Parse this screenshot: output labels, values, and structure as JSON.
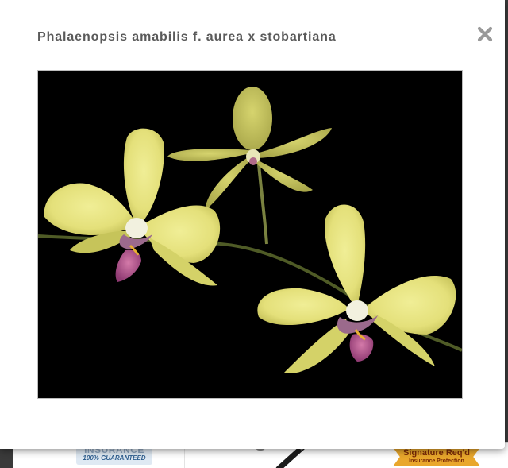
{
  "modal": {
    "title": "Phalaenopsis amabilis f. aurea x stobartiana",
    "close_icon": "close-icon"
  },
  "photo": {
    "subject": "orchid-flowers",
    "background_color": "#000000",
    "petal_color": "#e6e37e",
    "lip_color": "#b7458f"
  },
  "background_page": {
    "badges": [
      {
        "line1": "INSURANCE",
        "line2": "100% GUARANTEED"
      },
      {
        "icon": "pen-icon"
      },
      {
        "line1": "Signature Req'd",
        "line2": "Insurance Protection"
      }
    ]
  },
  "colors": {
    "title_text": "#5a5a5a",
    "close_icon": "#9a9a9a",
    "overlay": "#3a3a3a"
  }
}
